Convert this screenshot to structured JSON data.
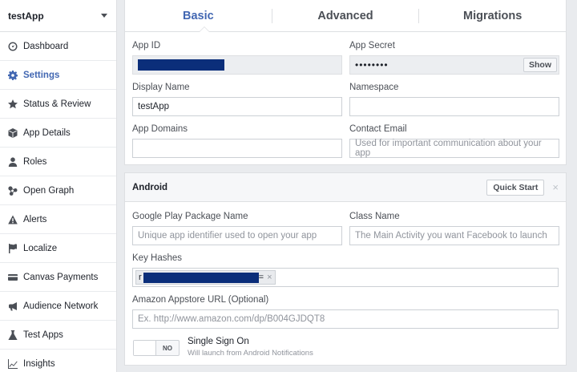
{
  "sidebar": {
    "app_name": "testApp",
    "items": [
      {
        "label": "Dashboard",
        "icon": "dashboard-icon"
      },
      {
        "label": "Settings",
        "icon": "gear-icon",
        "active": true
      },
      {
        "label": "Status & Review",
        "icon": "star-icon"
      },
      {
        "label": "App Details",
        "icon": "cube-icon"
      },
      {
        "label": "Roles",
        "icon": "person-icon"
      },
      {
        "label": "Open Graph",
        "icon": "graph-icon"
      },
      {
        "label": "Alerts",
        "icon": "warning-icon"
      },
      {
        "label": "Localize",
        "icon": "flag-icon"
      },
      {
        "label": "Canvas Payments",
        "icon": "card-icon"
      },
      {
        "label": "Audience Network",
        "icon": "megaphone-icon"
      },
      {
        "label": "Test Apps",
        "icon": "flask-icon"
      },
      {
        "label": "Insights",
        "icon": "chart-icon"
      }
    ]
  },
  "tabs": [
    {
      "label": "Basic",
      "active": true
    },
    {
      "label": "Advanced"
    },
    {
      "label": "Migrations"
    }
  ],
  "basic": {
    "app_id_label": "App ID",
    "app_secret_label": "App Secret",
    "app_secret_value": "••••••••",
    "show_label": "Show",
    "display_name_label": "Display Name",
    "display_name_value": "testApp",
    "namespace_label": "Namespace",
    "namespace_value": "",
    "app_domains_label": "App Domains",
    "app_domains_value": "",
    "contact_email_label": "Contact Email",
    "contact_email_placeholder": "Used for important communication about your app"
  },
  "android": {
    "title": "Android",
    "quick_start_label": "Quick Start",
    "close_glyph": "×",
    "package_label": "Google Play Package Name",
    "package_placeholder": "Unique app identifier used to open your app",
    "class_label": "Class Name",
    "class_placeholder": "The Main Activity you want Facebook to launch",
    "key_hashes_label": "Key Hashes",
    "key_hash_prefix": "r",
    "key_hash_suffix": "=",
    "token_remove_glyph": "×",
    "amazon_label": "Amazon Appstore URL (Optional)",
    "amazon_placeholder": "Ex. http://www.amazon.com/dp/B004GJDQT8",
    "sso_toggle_text": "NO",
    "sso_title": "Single Sign On",
    "sso_subtitle": "Will launch from Android Notifications"
  },
  "colors": {
    "accent": "#4267b2",
    "redaction": "#0b2e7a",
    "background": "#e9ebee"
  }
}
